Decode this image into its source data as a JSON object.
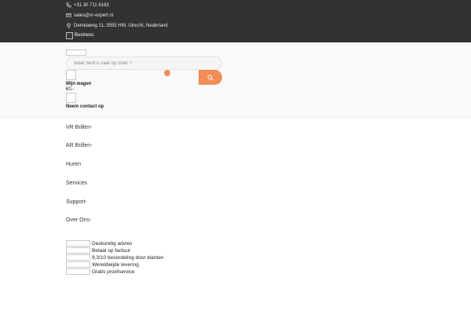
{
  "topbar": {
    "phone": "+31 30 711 6183",
    "email": "sales@vr-expert.nl",
    "address": "Demkaweg 11, 3555 HW, Utrecht, Nederland",
    "business_label": "Business"
  },
  "header": {
    "search_placeholder": "Waar bent u naar op zoek ?",
    "cart_label": "Mijn wagen",
    "cart_amount": "€0,-",
    "contact_label": "Neem contact op"
  },
  "nav": {
    "items": [
      {
        "label": "VR Brillen-"
      },
      {
        "label": "AR Brillen-"
      },
      {
        "label": "Huren"
      },
      {
        "label": "Services"
      },
      {
        "label": "Support-"
      },
      {
        "label": "Over Ons-"
      }
    ]
  },
  "usps": [
    {
      "label": "Deskundig advies"
    },
    {
      "label": "Betaal op factuur"
    },
    {
      "label": "9,3/10 beoordeling door klanten"
    },
    {
      "label": "Wereldwijde levering"
    },
    {
      "label": "Gratis proefservice"
    }
  ],
  "colors": {
    "topbar_bg": "#323232",
    "accent": "#f28d57"
  },
  "icons": [
    "phone-icon",
    "mail-icon",
    "location-icon",
    "search-icon"
  ]
}
